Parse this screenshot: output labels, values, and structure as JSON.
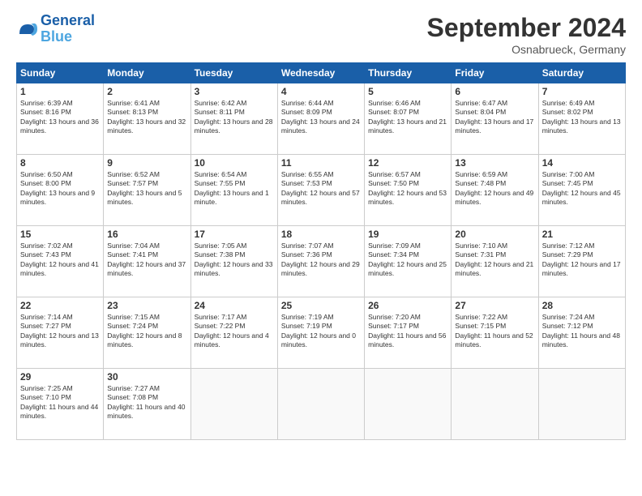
{
  "header": {
    "logo_line1": "General",
    "logo_line2": "Blue",
    "title": "September 2024",
    "location": "Osnabrueck, Germany"
  },
  "days_of_week": [
    "Sunday",
    "Monday",
    "Tuesday",
    "Wednesday",
    "Thursday",
    "Friday",
    "Saturday"
  ],
  "weeks": [
    [
      {
        "day": "1",
        "sunrise": "6:39 AM",
        "sunset": "8:16 PM",
        "daylight": "13 hours and 36 minutes."
      },
      {
        "day": "2",
        "sunrise": "6:41 AM",
        "sunset": "8:13 PM",
        "daylight": "13 hours and 32 minutes."
      },
      {
        "day": "3",
        "sunrise": "6:42 AM",
        "sunset": "8:11 PM",
        "daylight": "13 hours and 28 minutes."
      },
      {
        "day": "4",
        "sunrise": "6:44 AM",
        "sunset": "8:09 PM",
        "daylight": "13 hours and 24 minutes."
      },
      {
        "day": "5",
        "sunrise": "6:46 AM",
        "sunset": "8:07 PM",
        "daylight": "13 hours and 21 minutes."
      },
      {
        "day": "6",
        "sunrise": "6:47 AM",
        "sunset": "8:04 PM",
        "daylight": "13 hours and 17 minutes."
      },
      {
        "day": "7",
        "sunrise": "6:49 AM",
        "sunset": "8:02 PM",
        "daylight": "13 hours and 13 minutes."
      }
    ],
    [
      {
        "day": "8",
        "sunrise": "6:50 AM",
        "sunset": "8:00 PM",
        "daylight": "13 hours and 9 minutes."
      },
      {
        "day": "9",
        "sunrise": "6:52 AM",
        "sunset": "7:57 PM",
        "daylight": "13 hours and 5 minutes."
      },
      {
        "day": "10",
        "sunrise": "6:54 AM",
        "sunset": "7:55 PM",
        "daylight": "13 hours and 1 minute."
      },
      {
        "day": "11",
        "sunrise": "6:55 AM",
        "sunset": "7:53 PM",
        "daylight": "12 hours and 57 minutes."
      },
      {
        "day": "12",
        "sunrise": "6:57 AM",
        "sunset": "7:50 PM",
        "daylight": "12 hours and 53 minutes."
      },
      {
        "day": "13",
        "sunrise": "6:59 AM",
        "sunset": "7:48 PM",
        "daylight": "12 hours and 49 minutes."
      },
      {
        "day": "14",
        "sunrise": "7:00 AM",
        "sunset": "7:45 PM",
        "daylight": "12 hours and 45 minutes."
      }
    ],
    [
      {
        "day": "15",
        "sunrise": "7:02 AM",
        "sunset": "7:43 PM",
        "daylight": "12 hours and 41 minutes."
      },
      {
        "day": "16",
        "sunrise": "7:04 AM",
        "sunset": "7:41 PM",
        "daylight": "12 hours and 37 minutes."
      },
      {
        "day": "17",
        "sunrise": "7:05 AM",
        "sunset": "7:38 PM",
        "daylight": "12 hours and 33 minutes."
      },
      {
        "day": "18",
        "sunrise": "7:07 AM",
        "sunset": "7:36 PM",
        "daylight": "12 hours and 29 minutes."
      },
      {
        "day": "19",
        "sunrise": "7:09 AM",
        "sunset": "7:34 PM",
        "daylight": "12 hours and 25 minutes."
      },
      {
        "day": "20",
        "sunrise": "7:10 AM",
        "sunset": "7:31 PM",
        "daylight": "12 hours and 21 minutes."
      },
      {
        "day": "21",
        "sunrise": "7:12 AM",
        "sunset": "7:29 PM",
        "daylight": "12 hours and 17 minutes."
      }
    ],
    [
      {
        "day": "22",
        "sunrise": "7:14 AM",
        "sunset": "7:27 PM",
        "daylight": "12 hours and 13 minutes."
      },
      {
        "day": "23",
        "sunrise": "7:15 AM",
        "sunset": "7:24 PM",
        "daylight": "12 hours and 8 minutes."
      },
      {
        "day": "24",
        "sunrise": "7:17 AM",
        "sunset": "7:22 PM",
        "daylight": "12 hours and 4 minutes."
      },
      {
        "day": "25",
        "sunrise": "7:19 AM",
        "sunset": "7:19 PM",
        "daylight": "12 hours and 0 minutes."
      },
      {
        "day": "26",
        "sunrise": "7:20 AM",
        "sunset": "7:17 PM",
        "daylight": "11 hours and 56 minutes."
      },
      {
        "day": "27",
        "sunrise": "7:22 AM",
        "sunset": "7:15 PM",
        "daylight": "11 hours and 52 minutes."
      },
      {
        "day": "28",
        "sunrise": "7:24 AM",
        "sunset": "7:12 PM",
        "daylight": "11 hours and 48 minutes."
      }
    ],
    [
      {
        "day": "29",
        "sunrise": "7:25 AM",
        "sunset": "7:10 PM",
        "daylight": "11 hours and 44 minutes."
      },
      {
        "day": "30",
        "sunrise": "7:27 AM",
        "sunset": "7:08 PM",
        "daylight": "11 hours and 40 minutes."
      },
      null,
      null,
      null,
      null,
      null
    ]
  ]
}
